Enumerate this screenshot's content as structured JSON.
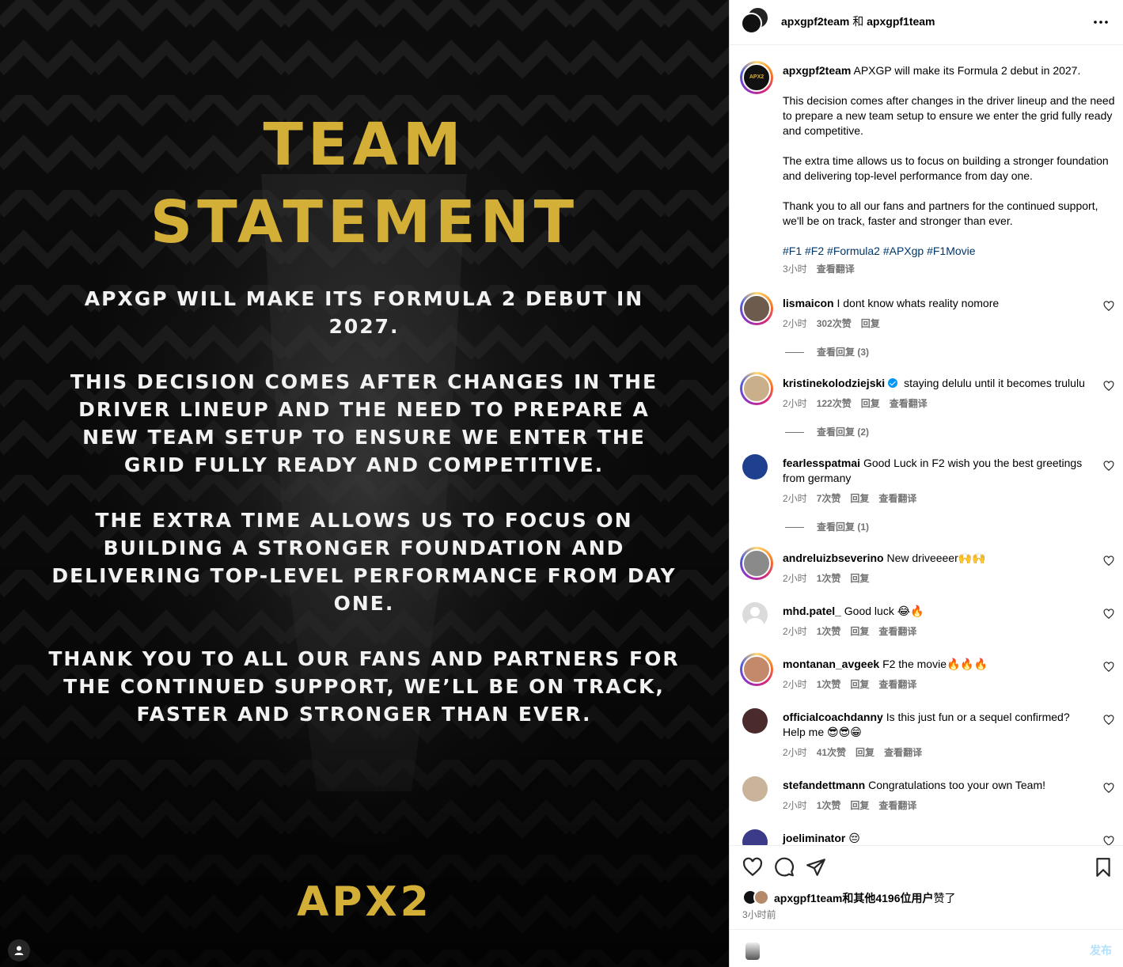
{
  "media": {
    "headline_line1": "TEAM",
    "headline_line2": "STATEMENT",
    "paragraphs": [
      "APXGP will make its Formula 2 debut in 2027.",
      "This decision comes after changes in the driver lineup and the need to prepare a new team setup to ensure we enter the grid fully ready and competitive.",
      "The extra time allows us to focus on building a stronger foundation and delivering top-level performance from day one.",
      "Thank you to all our fans and partners for the continued support, we’ll be on track, faster and stronger than ever."
    ],
    "logo_text": "APX2",
    "accent_color": "#d4af37"
  },
  "header": {
    "account1": "apxgpf2team",
    "joiner": " 和 ",
    "account2": "apxgpf1team",
    "more_icon": "more-horizontal-icon"
  },
  "caption": {
    "username": "apxgpf2team",
    "first_line": "APXGP will make its Formula 2 debut in 2027.",
    "paragraph2": "This decision comes after changes in the driver lineup and the need to prepare a new team setup to ensure we enter the grid fully ready and competitive.",
    "paragraph3": "The extra time allows us to focus on building a stronger foundation and delivering top-level performance from day one.",
    "paragraph4": "Thank you to all our fans and partners for the continued support, we'll be on track, faster and stronger than ever.",
    "hashtags": "#F1 #F2 #Formula2 #APXgp #F1Movie",
    "time": "3小时",
    "translate": "查看翻译"
  },
  "comments": [
    {
      "username": "lismaicon",
      "text": "I dont know whats reality nomore",
      "time": "2小时",
      "likes": "302次赞",
      "reply": "回复",
      "translate": "",
      "view_replies": "查看回复 (3)"
    },
    {
      "username": "kristinekolodziejski",
      "verified": true,
      "text": "staying delulu until it becomes trululu",
      "time": "2小时",
      "likes": "122次赞",
      "reply": "回复",
      "translate": "查看翻译",
      "view_replies": "查看回复 (2)"
    },
    {
      "username": "fearlesspatmai",
      "text": "Good Luck in F2 wish you the best greetings from germany",
      "time": "2小时",
      "likes": "7次赞",
      "reply": "回复",
      "translate": "查看翻译",
      "view_replies": "查看回复 (1)"
    },
    {
      "username": "andreluizbseverino",
      "text": "New driveeeer🙌🙌",
      "time": "2小时",
      "likes": "1次赞",
      "reply": "回复",
      "translate": "",
      "view_replies": ""
    },
    {
      "username": "mhd.patel_",
      "text": "Good luck 😂🔥",
      "time": "2小时",
      "likes": "1次赞",
      "reply": "回复",
      "translate": "查看翻译",
      "view_replies": ""
    },
    {
      "username": "montanan_avgeek",
      "text": "F2 the movie🔥🔥🔥",
      "time": "2小时",
      "likes": "1次赞",
      "reply": "回复",
      "translate": "查看翻译",
      "view_replies": ""
    },
    {
      "username": "officialcoachdanny",
      "text": "Is this just fun or a sequel confirmed? Help me 😎😎😁",
      "time": "2小时",
      "likes": "41次赞",
      "reply": "回复",
      "translate": "查看翻译",
      "view_replies": ""
    },
    {
      "username": "stefandettmann",
      "text": "Congratulations too your own Team!",
      "time": "2小时",
      "likes": "1次赞",
      "reply": "回复",
      "translate": "查看翻译",
      "view_replies": ""
    },
    {
      "username": "joeliminator",
      "text": "😔",
      "time": "",
      "likes": "",
      "reply": "",
      "translate": "",
      "view_replies": ""
    }
  ],
  "actions": {
    "like_icon": "heart-icon",
    "comment_icon": "comment-icon",
    "share_icon": "paper-plane-icon",
    "save_icon": "bookmark-icon"
  },
  "likes_summary": {
    "user": "apxgpf1team",
    "rest_bold": "和其他4196位用户",
    "suffix": "赞了"
  },
  "post_time": "3小时前",
  "composer": {
    "placeholder": "",
    "post_label": "发布"
  }
}
